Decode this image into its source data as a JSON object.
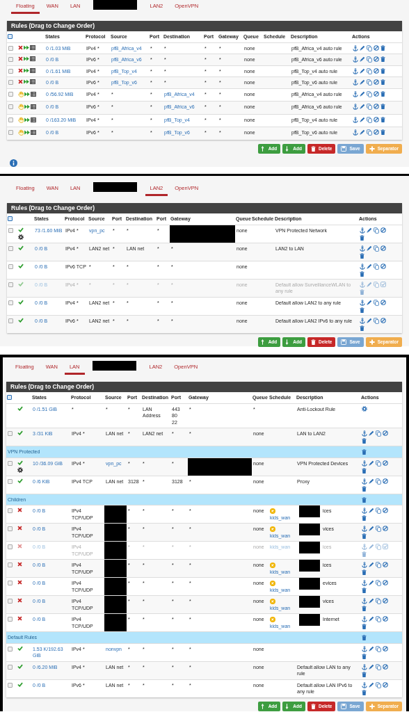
{
  "panels": [
    {
      "tabs": [
        {
          "label": "Floating",
          "selected": true
        },
        {
          "label": "WAN",
          "selected": false
        },
        {
          "label": "LAN",
          "selected": false
        },
        {
          "redacted": true,
          "selected": false
        },
        {
          "label": "LAN2",
          "selected": false
        },
        {
          "label": "OpenVPN",
          "selected": false
        }
      ],
      "title": "Rules (Drag to Change Order)",
      "select_all": false,
      "columns": [
        "States",
        "Protocol",
        "Source",
        "Port",
        "Destination",
        "Port",
        "Gateway",
        "Queue",
        "Schedule",
        "Description",
        "Actions"
      ],
      "rules": [
        {
          "kind": "block",
          "quick": true,
          "log": true,
          "selected": false,
          "states": "0 /1.03 MiB",
          "protocol": "IPv4 *",
          "source": "pfB_Africa_v4",
          "source_link": true,
          "source_port": "*",
          "destination": "*",
          "destination_port": "*",
          "gateway": "*",
          "queue": "none",
          "description": "pfB_Africa_v4 auto rule"
        },
        {
          "kind": "block",
          "quick": true,
          "log": true,
          "selected": false,
          "states": "0 /0 B",
          "protocol": "IPv6 *",
          "source": "pfB_Africa_v6",
          "source_link": true,
          "source_port": "*",
          "destination": "*",
          "destination_port": "*",
          "gateway": "*",
          "queue": "none",
          "description": "pfB_Africa_v6 auto rule"
        },
        {
          "kind": "block",
          "quick": true,
          "log": true,
          "selected": false,
          "states": "0 /1.61 MiB",
          "protocol": "IPv4 *",
          "source": "pfB_Top_v4",
          "source_link": true,
          "source_port": "*",
          "destination": "*",
          "destination_port": "*",
          "gateway": "*",
          "queue": "none",
          "description": "pfB_Top_v4 auto rule"
        },
        {
          "kind": "block",
          "quick": true,
          "log": true,
          "selected": false,
          "states": "0 /0 B",
          "protocol": "IPv6 *",
          "source": "pfB_Top_v6",
          "source_link": true,
          "source_port": "*",
          "destination": "*",
          "destination_port": "*",
          "gateway": "*",
          "queue": "none",
          "description": "pfB_Top_v6 auto rule"
        },
        {
          "kind": "reject",
          "quick": true,
          "log": true,
          "selected": false,
          "states": "0 /56.92 MiB",
          "protocol": "IPv4 *",
          "source": "*",
          "source_port": "*",
          "destination": "pfB_Africa_v4",
          "destination_link": true,
          "destination_port": "*",
          "gateway": "*",
          "queue": "none",
          "description": "pfB_Africa_v4 auto rule"
        },
        {
          "kind": "reject",
          "quick": true,
          "log": true,
          "selected": false,
          "states": "0 /0 B",
          "protocol": "IPv6 *",
          "source": "*",
          "source_port": "*",
          "destination": "pfB_Africa_v6",
          "destination_link": true,
          "destination_port": "*",
          "gateway": "*",
          "queue": "none",
          "description": "pfB_Africa_v6 auto rule"
        },
        {
          "kind": "reject",
          "quick": true,
          "log": true,
          "selected": false,
          "states": "0 /163.20 MiB",
          "protocol": "IPv4 *",
          "source": "*",
          "source_port": "*",
          "destination": "pfB_Top_v4",
          "destination_link": true,
          "destination_port": "*",
          "gateway": "*",
          "queue": "none",
          "description": "pfB_Top_v4 auto rule"
        },
        {
          "kind": "reject",
          "quick": true,
          "log": true,
          "selected": false,
          "states": "0 /0 B",
          "protocol": "IPv6 *",
          "source": "*",
          "source_port": "*",
          "destination": "pfB_Top_v6",
          "destination_link": true,
          "destination_port": "*",
          "gateway": "*",
          "queue": "none",
          "description": "pfB_Top_v6 auto rule"
        }
      ],
      "buttons": [
        {
          "kind": "add-top",
          "label": "Add"
        },
        {
          "kind": "add-bottom",
          "label": "Add"
        },
        {
          "kind": "delete",
          "label": "Delete"
        },
        {
          "kind": "save",
          "label": "Save"
        },
        {
          "kind": "separator",
          "label": "Separator"
        }
      ],
      "info_icon": true
    },
    {
      "tabs": [
        {
          "label": "Floating",
          "selected": false
        },
        {
          "label": "WAN",
          "selected": false
        },
        {
          "label": "LAN",
          "selected": false
        },
        {
          "redacted": true,
          "selected": false
        },
        {
          "label": "LAN2",
          "selected": true
        },
        {
          "label": "OpenVPN",
          "selected": false
        }
      ],
      "title": "Rules (Drag to Change Order)",
      "select_all": false,
      "columns": [
        "States",
        "Protocol",
        "Source",
        "Port",
        "Destination",
        "Port",
        "Gateway",
        "Queue",
        "Schedule",
        "Description",
        "Actions"
      ],
      "rules": [
        {
          "kind": "pass",
          "advanced": true,
          "selected": false,
          "states": "73 /1.60 MiB",
          "protocol": "IPv4 *",
          "source": "vpn_pc",
          "source_link": true,
          "source_port": "*",
          "destination": "*",
          "destination_port": "*",
          "gateway_redacted": true,
          "queue": "none",
          "description": "VPN Protected Network"
        },
        {
          "kind": "pass",
          "selected": false,
          "states": "0 /0 B",
          "protocol": "IPv4 *",
          "source": "LAN2 net",
          "source_port": "*",
          "destination": "LAN net",
          "destination_port": "*",
          "gateway": "*",
          "queue": "none",
          "description": "LAN2 to LAN"
        },
        {
          "kind": "pass",
          "selected": false,
          "states": "0 /0 B",
          "protocol": "IPv6 TCP",
          "source": "*",
          "source_port": "*",
          "destination": "*",
          "destination_port": "*",
          "gateway": "*",
          "queue": "none"
        },
        {
          "kind": "pass",
          "disabled": true,
          "selected": false,
          "states": "0 /0 B",
          "protocol": "IPv4 *",
          "source": "*",
          "source_port": "*",
          "destination": "*",
          "destination_port": "*",
          "gateway": "*",
          "queue": "none",
          "description": "Default allow SurveillanceWLAN to any rule"
        },
        {
          "kind": "pass",
          "selected": false,
          "states": "0 /0 B",
          "protocol": "IPv4 *",
          "source": "LAN2 net",
          "source_port": "*",
          "destination": "*",
          "destination_port": "*",
          "gateway": "*",
          "queue": "none",
          "description": "Default allow LAN2 to any rule"
        },
        {
          "kind": "pass",
          "selected": false,
          "states": "0 /0 B",
          "protocol": "IPv6 *",
          "source": "LAN2 net",
          "source_port": "*",
          "destination": "*",
          "destination_port": "*",
          "gateway": "*",
          "queue": "none",
          "description": "Default allow LAN2 IPv6 to any rule"
        }
      ],
      "buttons": [
        {
          "kind": "add-top",
          "label": "Add"
        },
        {
          "kind": "add-bottom",
          "label": "Add"
        },
        {
          "kind": "delete",
          "label": "Delete"
        },
        {
          "kind": "save",
          "label": "Save"
        },
        {
          "kind": "separator",
          "label": "Separator"
        }
      ]
    },
    {
      "tabs": [
        {
          "label": "Floating",
          "selected": false
        },
        {
          "label": "WAN",
          "selected": false
        },
        {
          "label": "LAN",
          "selected": true
        },
        {
          "redacted": true,
          "selected": false
        },
        {
          "label": "LAN2",
          "selected": false
        },
        {
          "label": "OpenVPN",
          "selected": false
        }
      ],
      "title": "Rules (Drag to Change Order)",
      "select_all": false,
      "columns": [
        "States",
        "Protocol",
        "Source",
        "Port",
        "Destination",
        "Port",
        "Gateway",
        "Queue",
        "Schedule",
        "Description",
        "Actions"
      ],
      "rules": [
        {
          "kind": "pass",
          "locked": true,
          "states": "0 /1.51 GiB",
          "protocol": "*",
          "source": "*",
          "source_port": "*",
          "destination": "LAN Address",
          "destination_port": "443\n80\n22",
          "gateway": "*",
          "queue": "*",
          "description": "Anti-Lockout Rule"
        },
        {
          "kind": "pass",
          "selected": false,
          "states": "3 /31 KiB",
          "protocol": "IPv4 *",
          "source": "LAN net",
          "source_port": "*",
          "destination": "LAN2 net",
          "destination_port": "*",
          "gateway": "*",
          "queue": "none",
          "description": "LAN to LAN2"
        },
        {
          "kind": "separator",
          "label": "VPN Protected"
        },
        {
          "kind": "pass",
          "advanced": true,
          "selected": false,
          "states": "10 /36.09 GiB",
          "protocol": "IPv4 *",
          "source": "vpn_pc",
          "source_link": true,
          "source_port": "*",
          "destination": "*",
          "destination_port": "*",
          "gateway_redacted": true,
          "queue": "none",
          "description": "VPN Protected Devices"
        },
        {
          "kind": "pass",
          "selected": false,
          "states": "0 /6 KiB",
          "protocol": "IPv4 TCP",
          "source": "LAN net",
          "source_port": "3128",
          "destination": "*",
          "destination_port": "3128",
          "gateway": "*",
          "queue": "none",
          "description": "Proxy"
        },
        {
          "kind": "separator",
          "label": "Children"
        },
        {
          "kind": "block",
          "selected": false,
          "states": "0 /0 B",
          "protocol": "IPv4 TCP/UDP",
          "source_redacted": true,
          "source_port": "*",
          "destination": "*",
          "destination_port": "*",
          "gateway": "*",
          "queue": "none",
          "schedule": "kids_wan",
          "schedule_link": true,
          "schedule_warning": true,
          "description_redacted": true,
          "description": "ices"
        },
        {
          "kind": "block",
          "selected": false,
          "states": "0 /0 B",
          "protocol": "IPv4 TCP/UDP",
          "source_redacted": true,
          "source_port": "*",
          "destination": "*",
          "destination_port": "*",
          "gateway": "*",
          "queue": "none",
          "schedule": "kids_wan",
          "schedule_link": true,
          "schedule_warning": true,
          "description_redacted": true,
          "description": "vices"
        },
        {
          "kind": "block",
          "disabled": true,
          "selected": false,
          "states": "0 /0 B",
          "protocol": "IPv4 TCP/UDP",
          "source_redacted": true,
          "source_port": "*",
          "destination": "*",
          "destination_port": "*",
          "gateway": "*",
          "queue": "none",
          "schedule": "kids_wan",
          "schedule_link": true,
          "description_redacted": true,
          "description": "ices"
        },
        {
          "kind": "block",
          "selected": false,
          "states": "0 /0 B",
          "protocol": "IPv4 TCP/UDP",
          "source_redacted": true,
          "source_port": "*",
          "destination": "*",
          "destination_port": "*",
          "gateway": "*",
          "queue": "none",
          "schedule": "kids_wan",
          "schedule_link": true,
          "schedule_warning": true,
          "description_redacted": true,
          "description": "ices"
        },
        {
          "kind": "block",
          "selected": false,
          "states": "0 /0 B",
          "protocol": "IPv4 TCP/UDP",
          "source_redacted": true,
          "source_port": "*",
          "destination": "*",
          "destination_port": "*",
          "gateway": "*",
          "queue": "none",
          "schedule": "kids_wan",
          "schedule_link": true,
          "schedule_warning": true,
          "description_redacted": true,
          "description": "evices"
        },
        {
          "kind": "block",
          "selected": false,
          "states": "0 /0 B",
          "protocol": "IPv4 TCP/UDP",
          "source_redacted": true,
          "source_port": "*",
          "destination": "*",
          "destination_port": "*",
          "gateway": "*",
          "queue": "none",
          "schedule": "kids_wan",
          "schedule_link": true,
          "schedule_warning": true,
          "description_redacted": true,
          "description": "vices"
        },
        {
          "kind": "block",
          "selected": false,
          "states": "0 /0 B",
          "protocol": "IPv4 TCP/UDP",
          "source_redacted": true,
          "source_port": "*",
          "destination": "*",
          "destination_port": "*",
          "gateway": "*",
          "queue": "none",
          "schedule": "kids_wan",
          "schedule_link": true,
          "schedule_warning": true,
          "description_redacted": true,
          "description": "Internet"
        },
        {
          "kind": "separator",
          "label": "Default Rules"
        },
        {
          "kind": "pass",
          "selected": false,
          "states": "1.53 K/192.63 GiB",
          "protocol": "IPv4 *",
          "source": "nonvpn",
          "source_link": true,
          "source_port": "*",
          "destination": "*",
          "destination_port": "*",
          "gateway": "*",
          "queue": "none"
        },
        {
          "kind": "pass",
          "selected": false,
          "states": "0 /6.20 MiB",
          "protocol": "IPv4 *",
          "source": "LAN net",
          "source_port": "*",
          "destination": "*",
          "destination_port": "*",
          "gateway": "*",
          "queue": "none",
          "description": "Default allow LAN to any rule"
        },
        {
          "kind": "pass",
          "selected": false,
          "states": "0 /0 B",
          "protocol": "IPv6 *",
          "source": "LAN net",
          "source_port": "*",
          "destination": "*",
          "destination_port": "*",
          "gateway": "*",
          "queue": "none",
          "description": "Default allow LAN IPv6 to any rule"
        }
      ],
      "buttons": [
        {
          "kind": "add-top",
          "label": "Add"
        },
        {
          "kind": "add-bottom",
          "label": "Add"
        },
        {
          "kind": "delete",
          "label": "Delete"
        },
        {
          "kind": "save",
          "label": "Save"
        },
        {
          "kind": "separator",
          "label": "Separator"
        }
      ]
    }
  ]
}
